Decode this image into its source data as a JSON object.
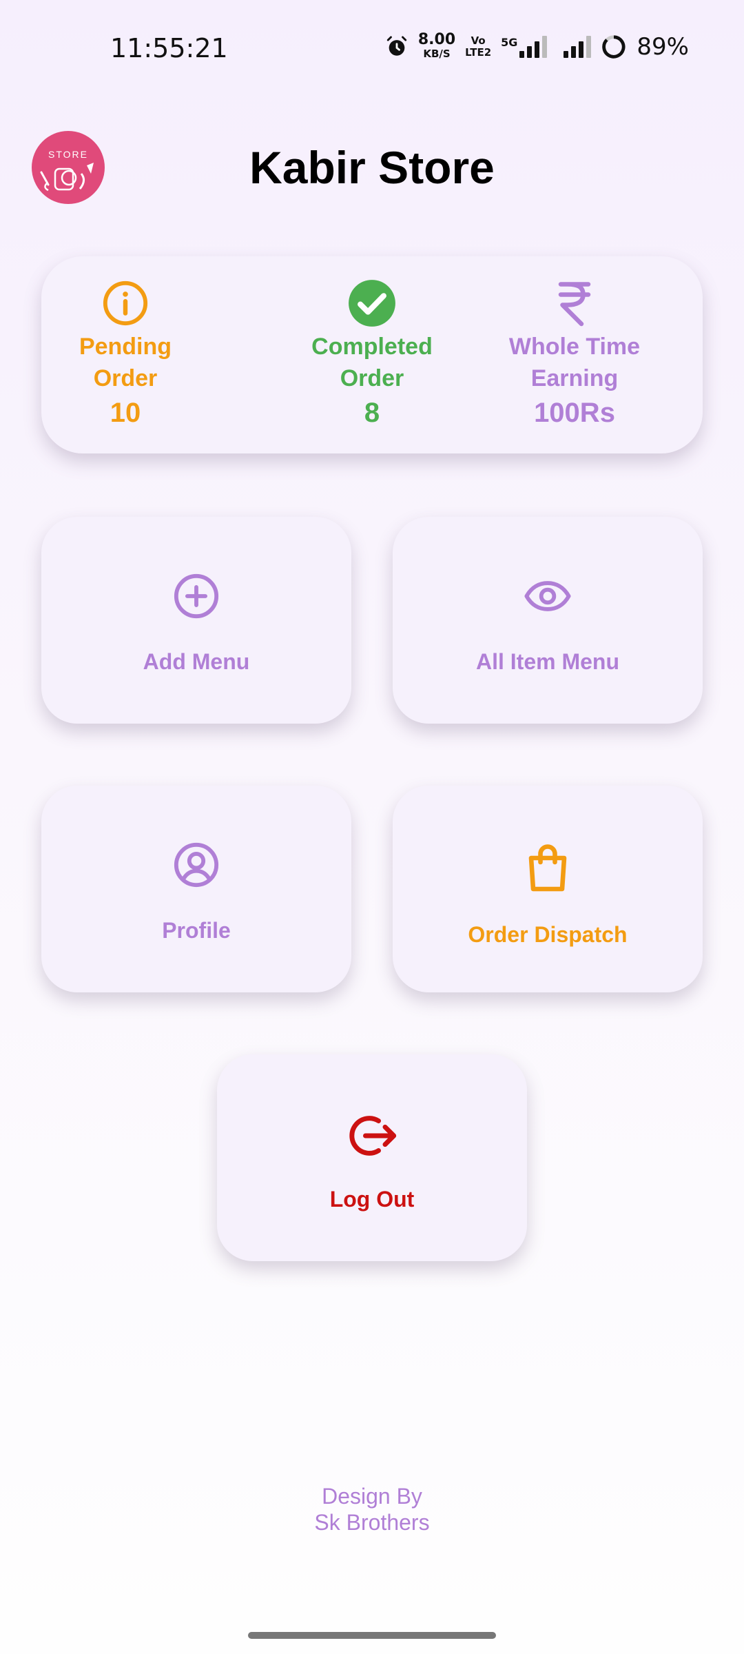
{
  "status_bar": {
    "time": "11:55:21",
    "net_speed": "8.00",
    "net_unit": "KB/S",
    "volte_top": "Vo",
    "volte_bottom": "LTE2",
    "network": "5G",
    "battery": "89%",
    "icons": [
      "alarm-icon",
      "signal-icon",
      "battery-ring-icon"
    ]
  },
  "header": {
    "logo_text": "STORE",
    "title": "Kabir Store"
  },
  "stats": [
    {
      "label_1": "Pending",
      "label_2": "Order",
      "value": "10",
      "color": "#f39c12",
      "icon": "info-circle-icon"
    },
    {
      "label_1": "Completed",
      "label_2": "Order",
      "value": "8",
      "color": "#4caf50",
      "icon": "check-circle-icon"
    },
    {
      "label_1": "Whole Time",
      "label_2": "Earning",
      "value": "100Rs",
      "color": "#b07fd6",
      "icon": "rupee-icon"
    }
  ],
  "tiles": {
    "add_menu": {
      "label": "Add Menu",
      "color": "#b07fd6",
      "icon": "plus-circle-icon"
    },
    "all_item_menu": {
      "label": "All Item Menu",
      "color": "#b07fd6",
      "icon": "eye-icon"
    },
    "profile": {
      "label": "Profile",
      "color": "#b07fd6",
      "icon": "user-circle-icon"
    },
    "order_dispatch": {
      "label": "Order Dispatch",
      "color": "#f39c12",
      "icon": "shopping-bag-icon"
    },
    "log_out": {
      "label": "Log Out",
      "color": "#cc1111",
      "icon": "logout-icon"
    }
  },
  "footer": {
    "line1": "Design By",
    "line2": "Sk Brothers"
  }
}
